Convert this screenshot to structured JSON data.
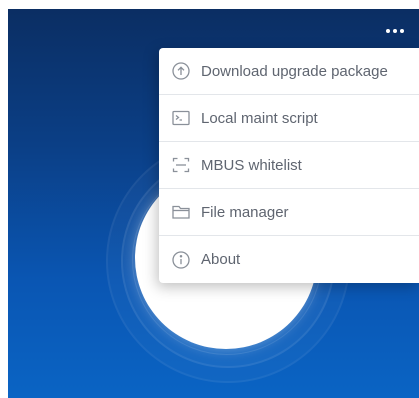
{
  "topbar": {
    "more_icon": "more-horizontal-icon"
  },
  "menu": {
    "items": [
      {
        "label": "Download upgrade package",
        "icon": "upload-circle-icon"
      },
      {
        "label": "Local maint script",
        "icon": "terminal-icon"
      },
      {
        "label": "MBUS whitelist",
        "icon": "scan-frame-icon"
      },
      {
        "label": "File manager",
        "icon": "folder-icon"
      },
      {
        "label": "About",
        "icon": "info-icon"
      }
    ]
  },
  "colors": {
    "background_top": "#0b2e63",
    "background_bottom": "#0a64c4",
    "menu_text": "#5f6570",
    "icon_stroke": "#8a9099"
  }
}
